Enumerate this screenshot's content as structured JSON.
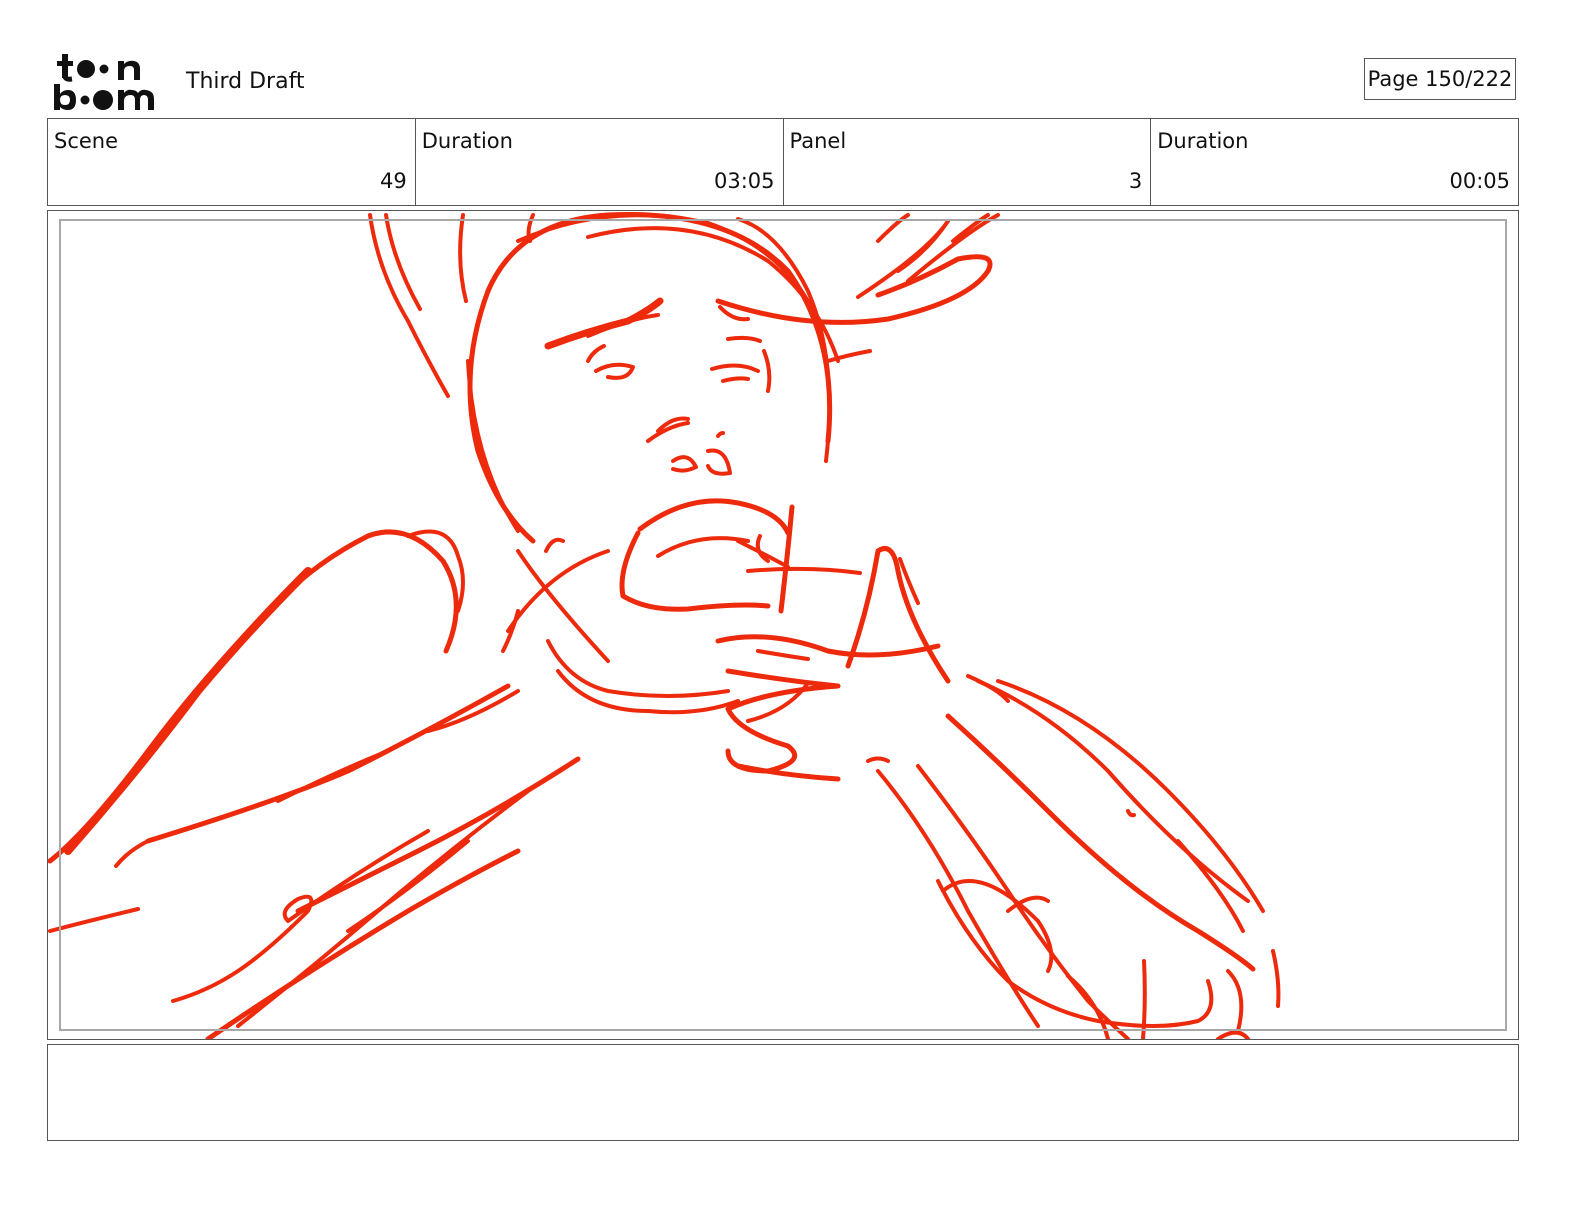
{
  "header": {
    "logo_text": "toon boom",
    "doc_title": "Third Draft",
    "page_label": "Page 150/222"
  },
  "info": {
    "scene_label": "Scene",
    "scene_value": "49",
    "scene_duration_label": "Duration",
    "scene_duration_value": "03:05",
    "panel_label": "Panel",
    "panel_value": "3",
    "panel_duration_label": "Duration",
    "panel_duration_value": "00:05"
  },
  "panel": {
    "sketch_color": "#ee2a0c",
    "safe_area_color": "#a8a8a8"
  },
  "notes": {
    "text": ""
  }
}
